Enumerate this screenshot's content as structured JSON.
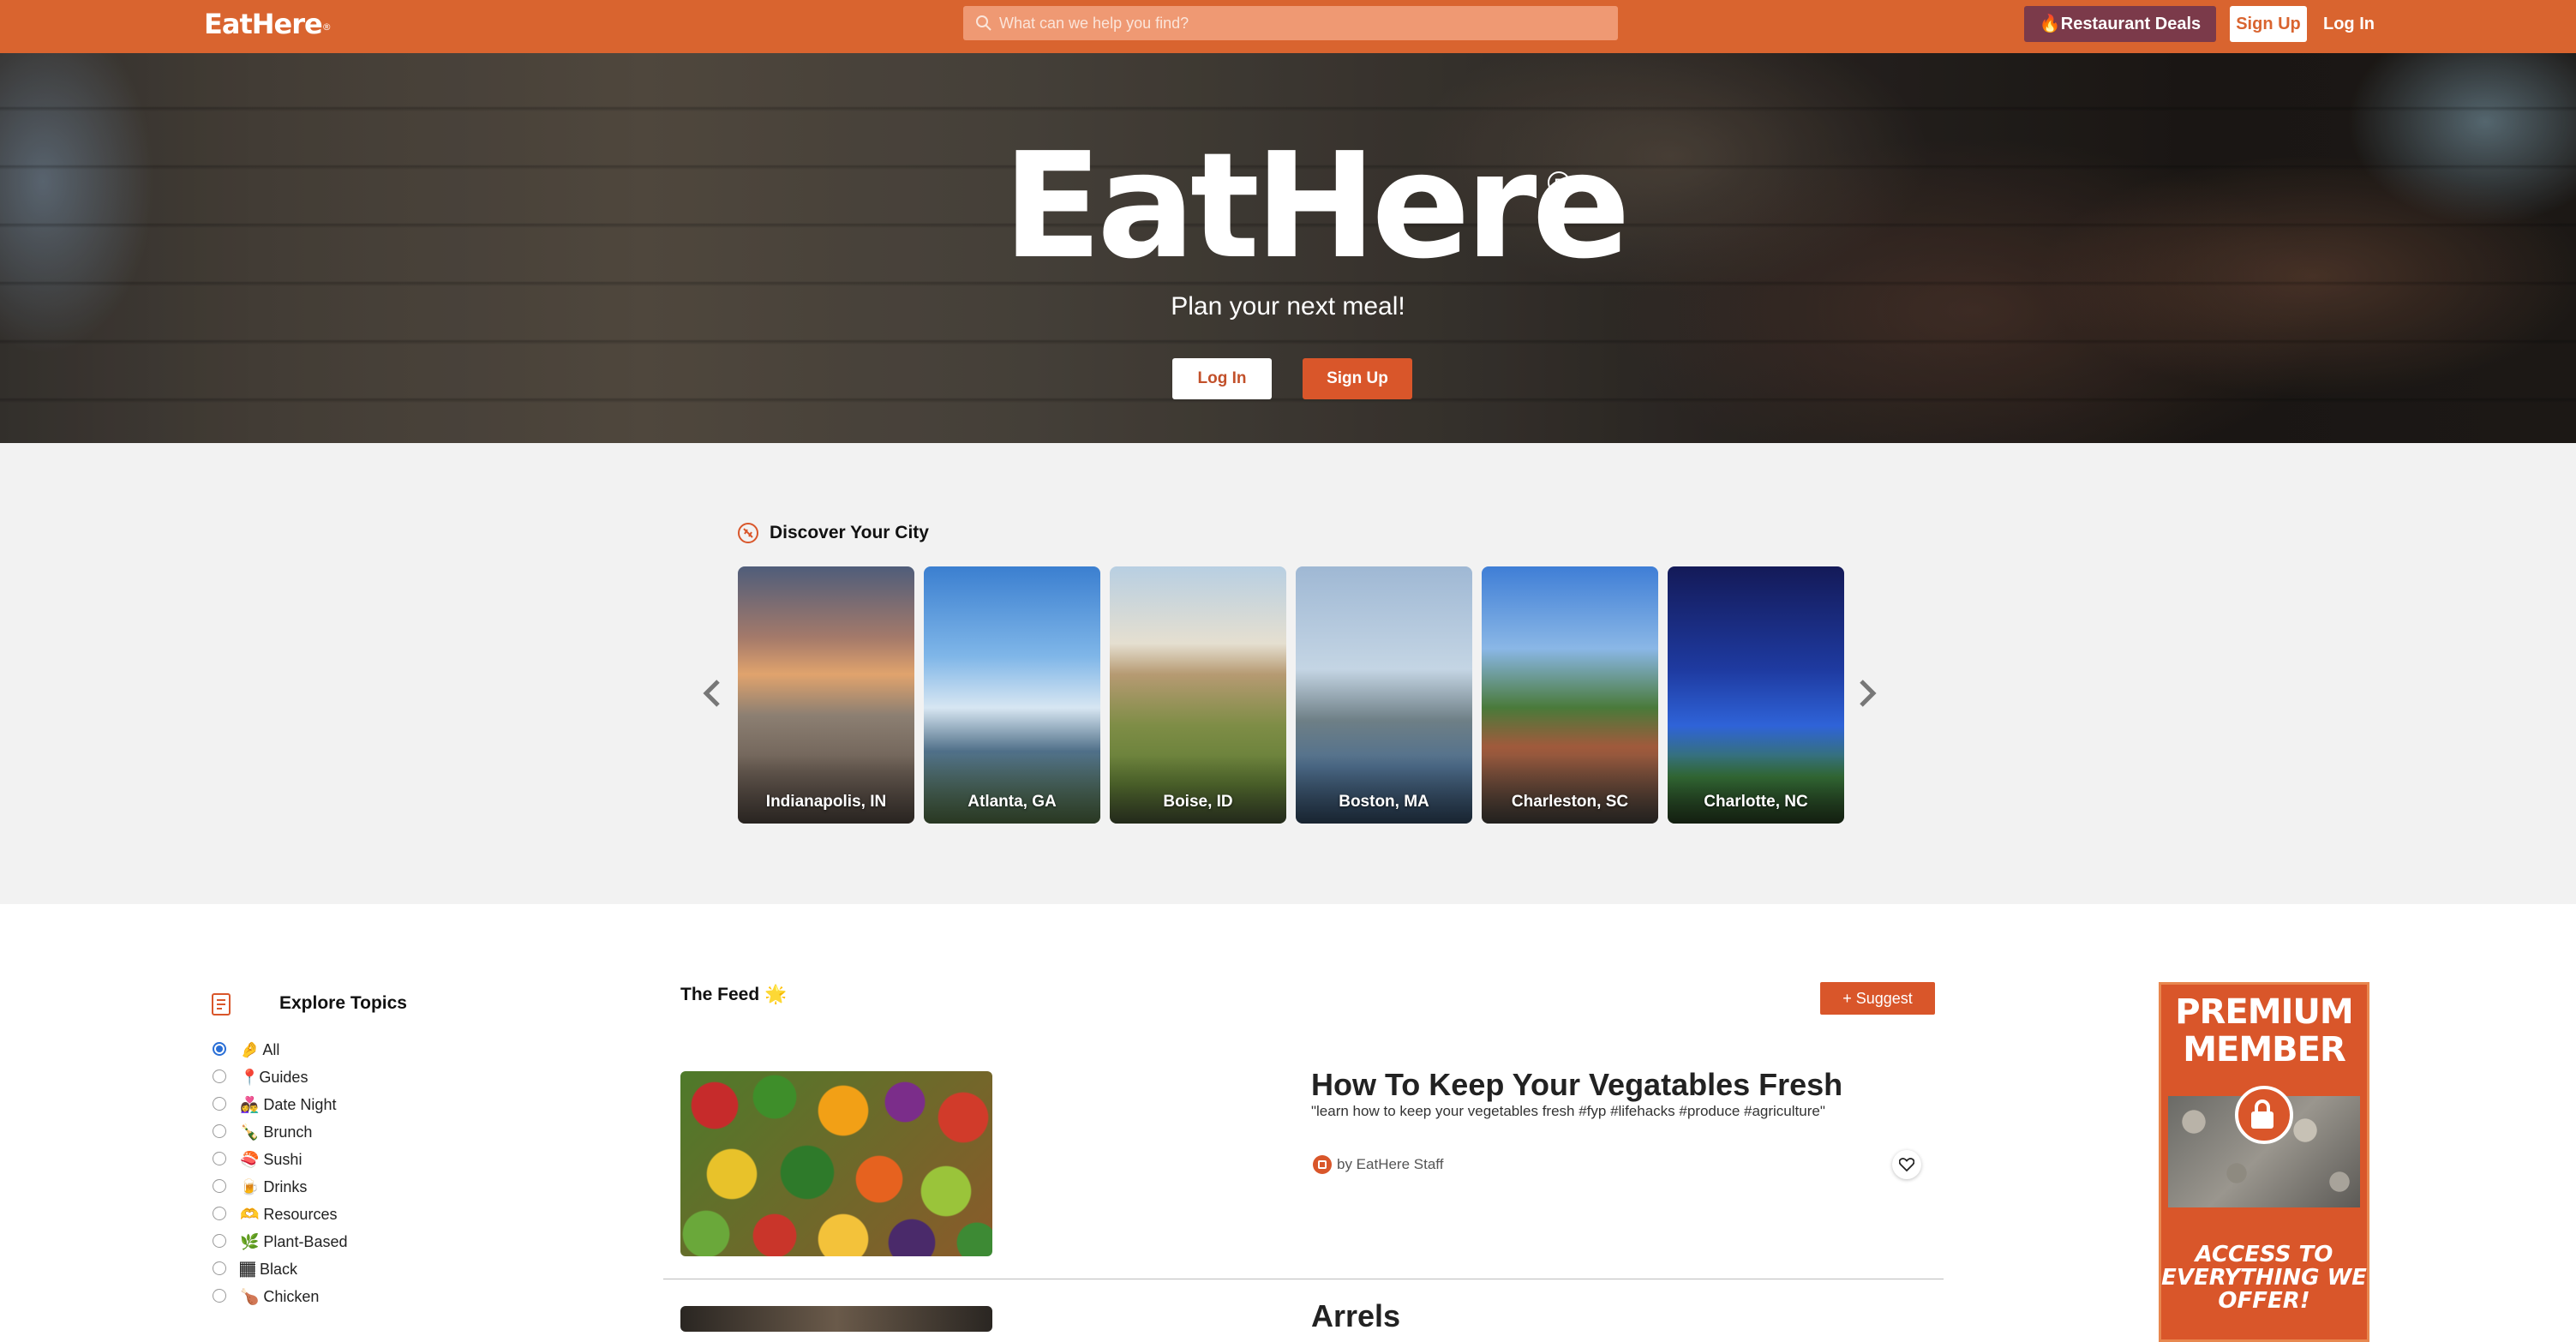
{
  "navbar": {
    "logo": "EatHere",
    "logo_mark": "®",
    "search_placeholder": "What can we help you find?",
    "deals_label": "🔥Restaurant Deals",
    "signup_label": "Sign Up",
    "login_label": "Log In",
    "accent_color": "#d9642f"
  },
  "hero": {
    "logo": "EatHere",
    "logo_mark": "R",
    "tagline": "Plan your next meal!",
    "login_label": "Log In",
    "signup_label": "Sign Up"
  },
  "discover": {
    "title": "Discover Your City",
    "cities": [
      {
        "name": "Indianapolis, IN"
      },
      {
        "name": "Atlanta, GA"
      },
      {
        "name": "Boise, ID"
      },
      {
        "name": "Boston, MA"
      },
      {
        "name": "Charleston, SC"
      },
      {
        "name": "Charlotte, NC"
      }
    ]
  },
  "topics": {
    "title": "Explore Topics",
    "items": [
      {
        "label": "🤌 All",
        "selected": true
      },
      {
        "label": "📍Guides",
        "selected": false
      },
      {
        "label": "👩‍❤️‍👨 Date Night",
        "selected": false
      },
      {
        "label": "🍾 Brunch",
        "selected": false
      },
      {
        "label": "🍣 Sushi",
        "selected": false
      },
      {
        "label": "🍺 Drinks",
        "selected": false
      },
      {
        "label": "🫶 Resources",
        "selected": false
      },
      {
        "label": "🌿 Plant-Based",
        "selected": false
      },
      {
        "label": "🏾 Black",
        "selected": false
      },
      {
        "label": "🍗 Chicken",
        "selected": false
      }
    ]
  },
  "feed": {
    "title": "The Feed 🌟",
    "suggest_label": "+ Suggest",
    "posts": [
      {
        "title": "How To Keep Your Vegatables Fresh",
        "description": "\"learn how to keep your vegetables fresh #fyp #lifehacks #produce #agriculture\"",
        "author": "by EatHere Staff"
      },
      {
        "title": "Arrels"
      }
    ]
  },
  "ad": {
    "line1": "PREMIUM",
    "line2": "MEMBER",
    "line3": "ACCESS TO EVERYTHING WE OFFER!"
  }
}
